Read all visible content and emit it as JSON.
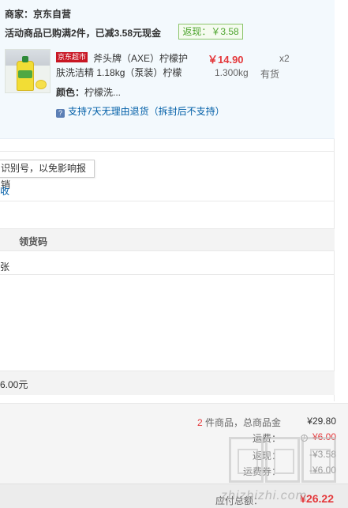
{
  "shop": {
    "merchant": "商家：京东自营",
    "promo": "活动商品已购满2件，已减3.58元现金",
    "rebate": "返现：￥3.58"
  },
  "item": {
    "badge": "京东超市",
    "name_line1": "斧头牌（AXE）柠檬护",
    "name_line2": "肤洗洁精 1.18kg（泵装）柠檬",
    "price": "￥14.90",
    "quantity": "x2",
    "weight": "1.300kg",
    "stock": "有货",
    "color_label": "颜色：",
    "color_value": "柠檬洗...",
    "return_policy": "支持7天无理由退货（拆封后不支持）",
    "return_icon": "?"
  },
  "invoice": {
    "tooltip": "识别号，以免影响报销",
    "fold_link": "收"
  },
  "pickup": {
    "header": "领货码",
    "cell": "张",
    "amount": "6.00元"
  },
  "summary": {
    "count": "2",
    "count_suffix": " 件商品，总商品金",
    "goods_total": "¥29.80",
    "shipping_label": "运费：",
    "shipping_value": "¥6.00",
    "info_icon": "!",
    "discount_label": "返现：",
    "discount_value": "-¥3.58",
    "coupon_label": "运费券：",
    "coupon_value": "-¥6.00",
    "payable_label": "应付总额：",
    "payable_value": "¥26.22"
  },
  "watermark": {
    "text": "zhizhizhi.com"
  },
  "colors": {
    "accent_red": "#e4393c",
    "link_blue": "#005ea7",
    "rebate_green": "#4ea52f",
    "panel_bg": "#f3f9fd",
    "badge_red": "#c81623"
  }
}
